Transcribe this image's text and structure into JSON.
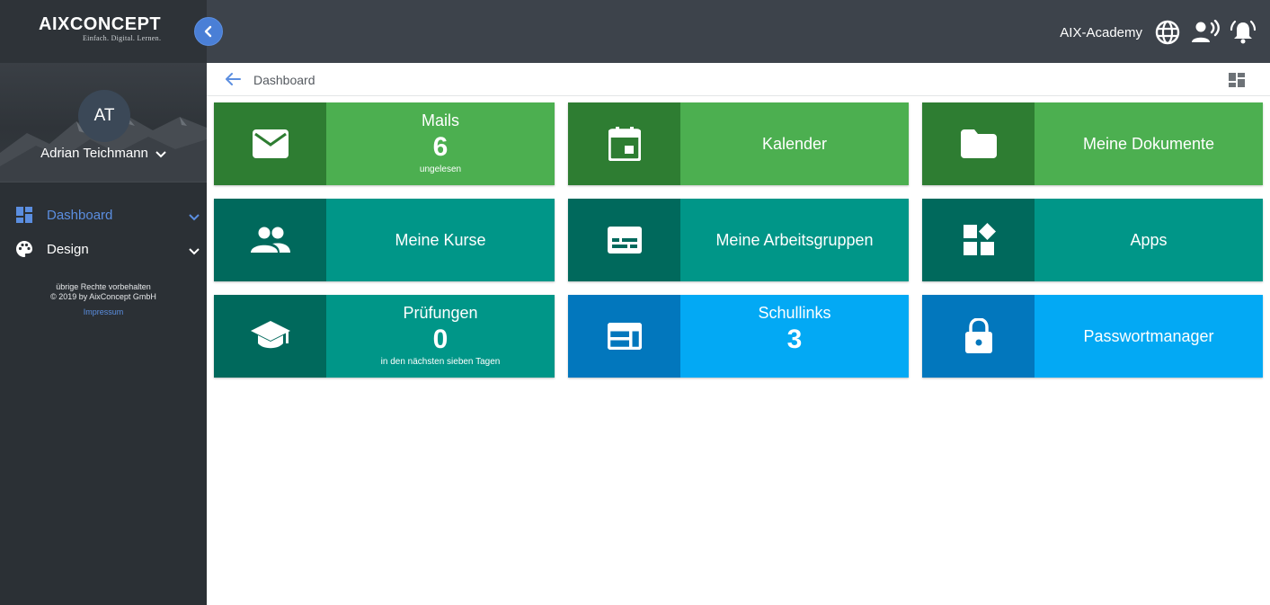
{
  "header": {
    "logo": "AIXCONCEPT",
    "logo_tagline": "Einfach. Digital. Lernen.",
    "school": "AIX-Academy",
    "icons": [
      "globe-icon",
      "voice-icon",
      "bell-icon"
    ]
  },
  "sidebar": {
    "user": {
      "initials": "AT",
      "name": "Adrian Teichmann"
    },
    "items": [
      {
        "label": "Dashboard",
        "icon": "dashboard-icon",
        "active": true
      },
      {
        "label": "Design",
        "icon": "palette-icon",
        "active": false
      }
    ],
    "footer_line1": "übrige Rechte vorbehalten",
    "footer_line2": "© 2019 by AixConcept GmbH",
    "footer_link": "Impressum"
  },
  "breadcrumb": {
    "label": "Dashboard"
  },
  "tiles": [
    {
      "title": "Mails",
      "count": "6",
      "subtitle": "ungelesen",
      "icon": "mail-icon",
      "color": "#4caf50"
    },
    {
      "title": "Kalender",
      "icon": "calendar-icon",
      "color": "#4caf50"
    },
    {
      "title": "Meine Dokumente",
      "icon": "folder-icon",
      "color": "#4caf50"
    },
    {
      "title": "Meine Kurse",
      "icon": "people-icon",
      "color": "#009688"
    },
    {
      "title": "Meine Arbeitsgruppen",
      "icon": "group-card-icon",
      "color": "#009688"
    },
    {
      "title": "Apps",
      "icon": "widgets-icon",
      "color": "#009688"
    },
    {
      "title": "Prüfungen",
      "count": "0",
      "subtitle": "in den nächsten sieben Tagen",
      "icon": "graduation-cap-icon",
      "color": "#009688"
    },
    {
      "title": "Schullinks",
      "count": "3",
      "icon": "web-icon",
      "color": "#03a9f4"
    },
    {
      "title": "Passwortmanager",
      "icon": "lock-icon",
      "color": "#03a9f4"
    }
  ]
}
